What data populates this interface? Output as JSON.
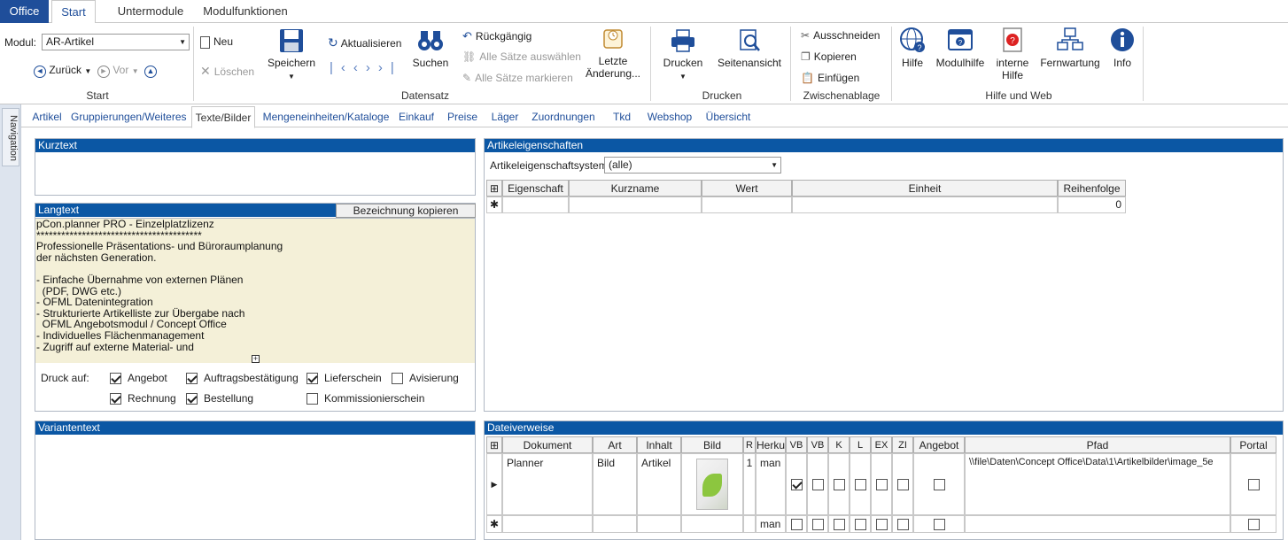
{
  "tabs": {
    "office": "Office",
    "start": "Start",
    "untermodule": "Untermodule",
    "modulfunktionen": "Modulfunktionen"
  },
  "ribbon": {
    "modul_label": "Modul:",
    "modul_value": "AR-Artikel",
    "zurueck": "Zurück",
    "vor": "Vor",
    "neu": "Neu",
    "loeschen": "Löschen",
    "speichern": "Speichern",
    "aktualisieren": "Aktualisieren",
    "suchen": "Suchen",
    "rueckgaengig": "Rückgängig",
    "alle_auswaehlen": "Alle Sätze auswählen",
    "alle_markieren": "Alle Sätze markieren",
    "letzte_aenderung_1": "Letzte",
    "letzte_aenderung_2": "Änderung...",
    "drucken": "Drucken",
    "seitenansicht": "Seitenansicht",
    "ausschneiden": "Ausschneiden",
    "kopieren": "Kopieren",
    "einfuegen": "Einfügen",
    "hilfe": "Hilfe",
    "modulhilfe": "Modulhilfe",
    "interne_hilfe_1": "interne",
    "interne_hilfe_2": "Hilfe",
    "fernwartung": "Fernwartung",
    "info": "Info",
    "groups": {
      "start": "Start",
      "datensatz": "Datensatz",
      "drucken": "Drucken",
      "zwischenablage": "Zwischenablage",
      "hilfe_web": "Hilfe und Web"
    }
  },
  "navigation": "Navigation",
  "subtabs": [
    "Artikel",
    "Gruppierungen/Weiteres",
    "Texte/Bilder",
    "Mengeneinheiten/Kataloge",
    "Einkauf",
    "Preise",
    "Läger",
    "Zuordnungen",
    "Tkd",
    "Webshop",
    "Übersicht"
  ],
  "kurztext": {
    "title": "Kurztext",
    "value": ""
  },
  "langtext": {
    "title": "Langtext",
    "copy_button": "Bezeichnung kopieren",
    "lines": [
      "pCon.planner PRO - Einzelplatzlizenz",
      "****************************************",
      "Professionelle Präsentations- und Büroraumplanung",
      "der nächsten Generation.",
      "",
      "- Einfache Übernahme von externen Plänen",
      "  (PDF, DWG etc.)",
      "- OFML Datenintegration",
      "- Strukturierte Artikelliste zur Übergabe nach",
      "  OFML Angebotsmodul / Concept Office",
      "- Individuelles Flächenmanagement",
      "- Zugriff auf externe Material- und"
    ]
  },
  "druck": {
    "label": "Druck auf:",
    "items": [
      {
        "label": "Angebot",
        "checked": true
      },
      {
        "label": "Auftragsbestätigung",
        "checked": true
      },
      {
        "label": "Lieferschein",
        "checked": true
      },
      {
        "label": "Avisierung",
        "checked": false
      },
      {
        "label": "Rechnung",
        "checked": true
      },
      {
        "label": "Bestellung",
        "checked": true
      },
      {
        "label": "Kommissionierschein",
        "checked": false
      }
    ]
  },
  "variantentext": {
    "title": "Variantentext",
    "value": ""
  },
  "artikeleigenschaften": {
    "title": "Artikeleigenschaften",
    "system_label": "Artikeleigenschaftsystem:",
    "system_value": "(alle)",
    "columns": [
      "Eigenschaft",
      "Kurzname",
      "Wert",
      "Einheit",
      "Reihenfolge"
    ],
    "new_row_reihenfolge": "0"
  },
  "dateiverweise": {
    "title": "Dateiverweise",
    "columns": [
      "Dokument",
      "Art",
      "Inhalt",
      "Bild",
      "R",
      "Herku",
      "VB",
      "VB",
      "K",
      "L",
      "EX",
      "ZI",
      "Angebot",
      "Pfad",
      "Portal"
    ],
    "row": {
      "dokument": "Planner",
      "art": "Bild",
      "inhalt": "Artikel",
      "r": "1",
      "herkunft": "man",
      "pfad": "\\\\file\\Daten\\Concept Office\\Data\\1\\Artikelbilder\\image_5e"
    },
    "new_row_herkunft": "man"
  }
}
